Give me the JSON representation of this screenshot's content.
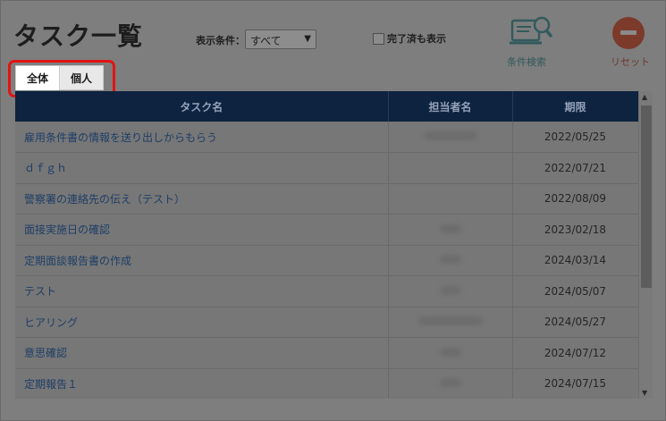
{
  "header": {
    "title": "タスク一覧",
    "condition_label": "表示条件：",
    "condition_value": "すべて",
    "show_done_label": "完了済も表示",
    "search_label": "条件検索",
    "reset_label": "リセット"
  },
  "tabs": [
    {
      "label": "全体",
      "active": true
    },
    {
      "label": "個人",
      "active": false
    }
  ],
  "table": {
    "columns": [
      "タスク名",
      "担当者名",
      "期限"
    ],
    "rows": [
      {
        "name": "雇用条件書の情報を送り出しからもらう",
        "date": "2022/05/25"
      },
      {
        "name": "ｄｆｇｈ",
        "date": "2022/07/21"
      },
      {
        "name": "警察署の連絡先の伝え（テスト）",
        "date": "2022/08/09"
      },
      {
        "name": "面接実施日の確認",
        "date": "2023/02/18"
      },
      {
        "name": "定期面談報告書の作成",
        "date": "2024/03/14"
      },
      {
        "name": "テスト",
        "date": "2024/05/07"
      },
      {
        "name": "ヒアリング",
        "date": "2024/05/27"
      },
      {
        "name": "意思確認",
        "date": "2024/07/12"
      },
      {
        "name": "定期報告１",
        "date": "2024/07/15"
      }
    ]
  },
  "colors": {
    "header_bg": "#0e2340",
    "highlight": "#e11414",
    "link": "#1e3e66"
  }
}
